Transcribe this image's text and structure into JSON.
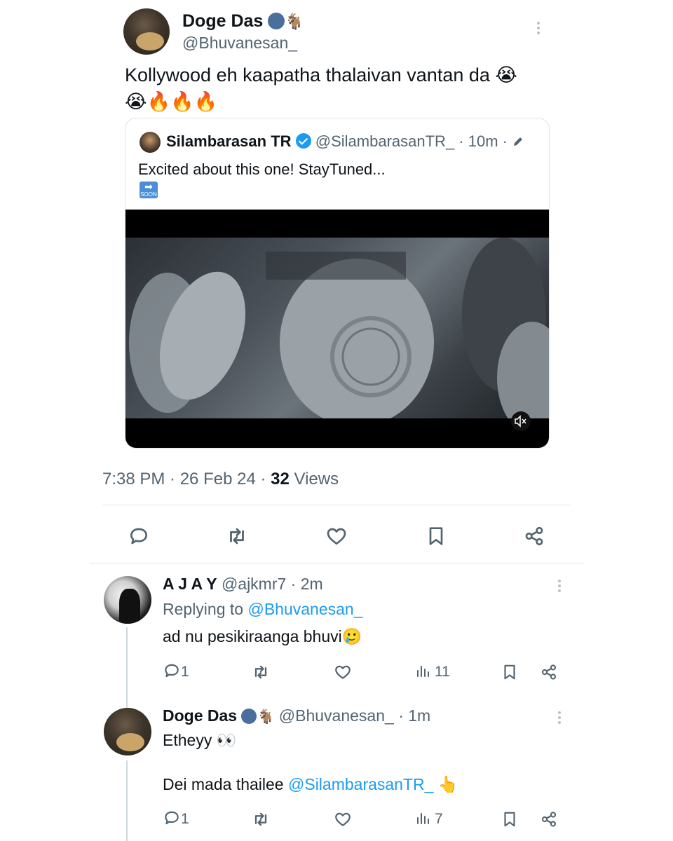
{
  "main_tweet": {
    "display_name": "Doge Das",
    "name_emojis": "🌚🐐",
    "handle": "@Bhuvanesan_",
    "text_line1": "Kollywood eh kaapatha thalaivan vantan da 😭",
    "text_line2": "😭🔥🔥🔥",
    "timestamp": "7:38 PM · 26 Feb 24 · ",
    "views_count": "32",
    "views_label": " Views"
  },
  "quoted_tweet": {
    "display_name": "Silambarasan TR",
    "handle_meta": "@SilambarasanTR_ · 10m · ",
    "text": "Excited about this one! StayTuned...",
    "soon_emoji": "🔜"
  },
  "reply1": {
    "display_name": "A J A Y",
    "handle_meta": "@ajkmr7 · 2m",
    "replying_prefix": "Replying to ",
    "replying_handle": "@Bhuvanesan_",
    "text": "ad nu pesikiraanga bhuvi🥲",
    "reply_count": "1",
    "views_count": "11"
  },
  "reply2": {
    "display_name": "Doge Das",
    "name_emojis": "🌚🐐",
    "handle_meta": "@Bhuvanesan_ · 1m",
    "text_line1": "Etheyy 👀",
    "text_prefix": "Dei mada thailee ",
    "mention": "@SilambarasanTR_",
    "text_suffix": " 👆",
    "reply_count": "1",
    "views_count": "7"
  },
  "icons": [
    "reply-icon",
    "retweet-icon",
    "like-icon",
    "bookmark-icon",
    "share-icon",
    "views-icon",
    "mute-icon",
    "edit-icon",
    "more-icon"
  ],
  "colors": {
    "accent": "#1d9bf0",
    "muted": "#536471",
    "text": "#0f1419"
  }
}
